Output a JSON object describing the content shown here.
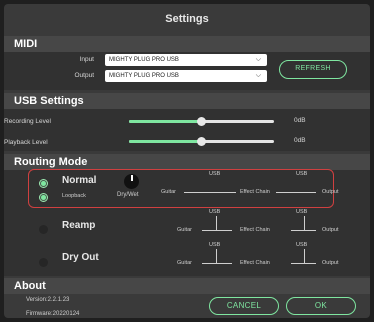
{
  "window": {
    "title": "Settings"
  },
  "midi": {
    "heading": "MIDI",
    "input_label": "Input",
    "input_value": "MIGHTY PLUG PRO USB",
    "output_label": "Output",
    "output_value": "MIGHTY PLUG PRO USB",
    "refresh_label": "REFRESH"
  },
  "usb": {
    "heading": "USB Settings",
    "recording_label": "Recording Level",
    "recording_value": "0dB",
    "recording_level": 0.5,
    "playback_label": "Playback Level",
    "playback_value": "0dB",
    "playback_level": 0.5
  },
  "routing": {
    "heading": "Routing Mode",
    "normal": {
      "name": "Normal",
      "loopback_label": "Loopback",
      "drywet_label": "Dry/Wet"
    },
    "reamp": {
      "name": "Reamp"
    },
    "dryout": {
      "name": "Dry Out"
    },
    "flow": {
      "guitar": "Guitar",
      "effect_chain": "Effect Chain",
      "output": "Output",
      "usb": "USB"
    }
  },
  "about": {
    "heading": "About",
    "version": "Version:2.2.1.23",
    "firmware": "Firmware:20220124"
  },
  "footer": {
    "cancel_label": "CANCEL",
    "ok_label": "OK"
  },
  "colors": {
    "accent": "#7fe6a0",
    "highlight": "#d04040"
  }
}
